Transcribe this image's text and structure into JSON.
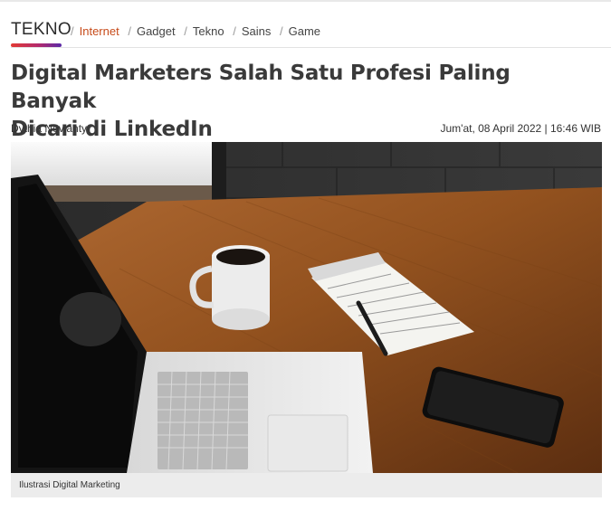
{
  "nav": {
    "brand": "TEKNO",
    "separator": "/",
    "items": [
      {
        "label": "Internet",
        "active": true
      },
      {
        "label": "Gadget",
        "active": false
      },
      {
        "label": "Tekno",
        "active": false
      },
      {
        "label": "Sains",
        "active": false
      },
      {
        "label": "Game",
        "active": false
      }
    ]
  },
  "article": {
    "title_line1": "Digital Marketers Salah Satu Profesi Paling Banyak",
    "title_line2": "Dicari di LinkedIn",
    "author": "Dythia Novianty",
    "date": "Jum'at, 08 April 2022 | 16:46 WIB",
    "image_caption": "Ilustrasi Digital Marketing"
  },
  "colors": {
    "active_crumb": "#c74b1a",
    "brand_gradient": [
      "#e23a34",
      "#b22a6d",
      "#5a2aa8"
    ]
  }
}
